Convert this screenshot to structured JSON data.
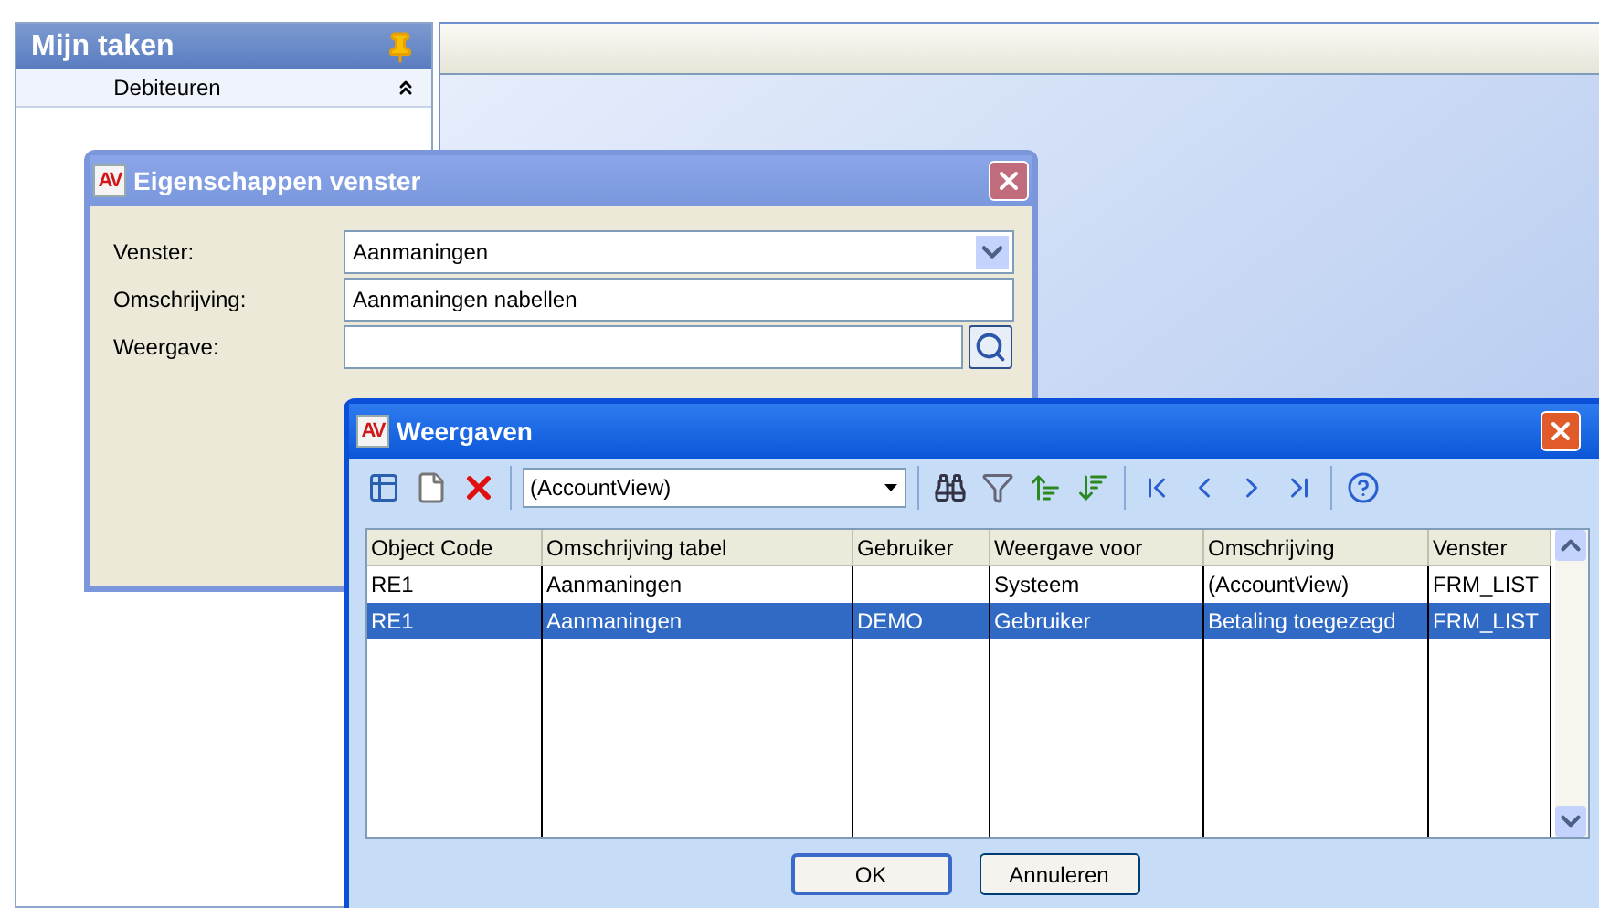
{
  "task_panel": {
    "title": "Mijn taken",
    "pinned": true,
    "groups": [
      {
        "label": "Debiteuren",
        "expanded": true
      }
    ]
  },
  "properties_dialog": {
    "logo": "AV",
    "title": "Eigenschappen venster",
    "fields": [
      {
        "label": "Venster:",
        "kind": "dropdown",
        "value": "Aanmaningen"
      },
      {
        "label": "Omschrijving:",
        "kind": "text",
        "value": "Aanmaningen nabellen"
      },
      {
        "label": "Weergave:",
        "kind": "lookup"
      }
    ]
  },
  "views_dialog": {
    "logo": "AV",
    "title": "Weergaven",
    "toolbar": {
      "view_select": "(AccountView)"
    },
    "table": {
      "columns": [
        "Object Code",
        "Omschrijving tabel",
        "Gebruiker",
        "Weergave voor",
        "Omschrijving",
        "Venster"
      ],
      "rows": [
        {
          "cells": [
            "RE1",
            "Aanmaningen",
            null,
            "Systeem",
            "(AccountView)",
            "FRM_LIST"
          ],
          "selected": false
        },
        {
          "cells": [
            "RE1",
            "Aanmaningen",
            "DEMO",
            "Gebruiker",
            "Betaling toegezegd",
            "FRM_LIST"
          ],
          "selected": true
        }
      ]
    },
    "buttons": [
      {
        "label": "OK",
        "default": true
      },
      {
        "label": "Annuleren",
        "default": false
      }
    ]
  }
}
